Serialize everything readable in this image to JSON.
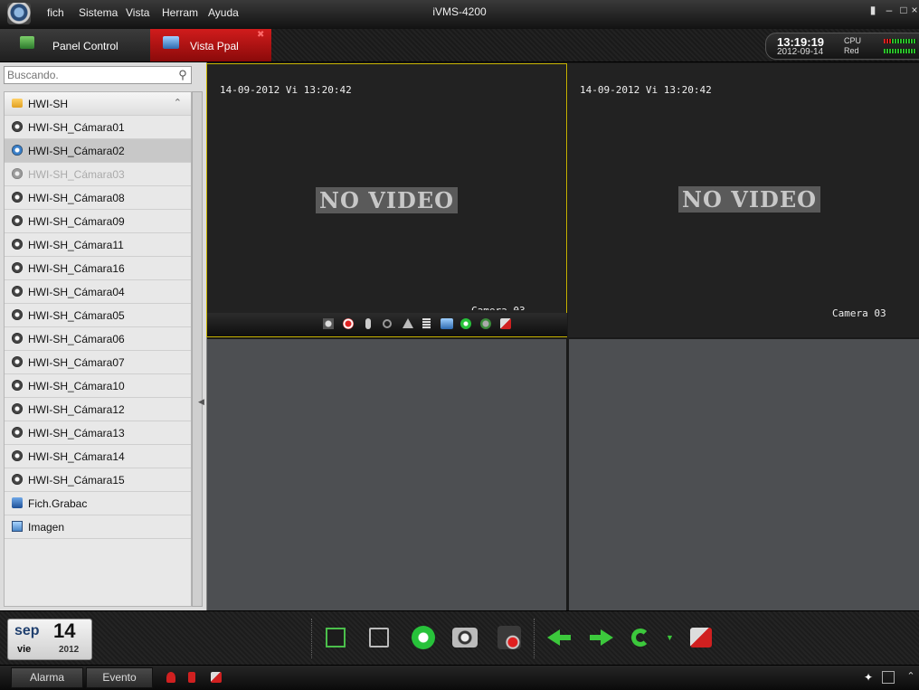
{
  "menubar": {
    "items": [
      "fich",
      "Sistema",
      "Vista",
      "Herram",
      "Ayuda"
    ],
    "title": "iVMS-4200"
  },
  "tabs": {
    "panel_control": "Panel Control",
    "vista_ppal": "Vista Ppal"
  },
  "clock": {
    "time": "13:19:19",
    "date": "2012-09-14",
    "cpu_label": "CPU",
    "net_label": "Red"
  },
  "search": {
    "placeholder": "Buscando."
  },
  "tree": {
    "group": "HWI-SH",
    "cameras": [
      {
        "label": "HWI-SH_Cámara01",
        "state": "normal"
      },
      {
        "label": "HWI-SH_Cámara02",
        "state": "selected"
      },
      {
        "label": "HWI-SH_Cámara03",
        "state": "disabled"
      },
      {
        "label": "HWI-SH_Cámara08",
        "state": "normal"
      },
      {
        "label": "HWI-SH_Cámara09",
        "state": "normal"
      },
      {
        "label": "HWI-SH_Cámara11",
        "state": "normal"
      },
      {
        "label": "HWI-SH_Cámara16",
        "state": "normal"
      },
      {
        "label": "HWI-SH_Cámara04",
        "state": "normal"
      },
      {
        "label": "HWI-SH_Cámara05",
        "state": "normal"
      },
      {
        "label": "HWI-SH_Cámara06",
        "state": "normal"
      },
      {
        "label": "HWI-SH_Cámara07",
        "state": "normal"
      },
      {
        "label": "HWI-SH_Cámara10",
        "state": "normal"
      },
      {
        "label": "HWI-SH_Cámara12",
        "state": "normal"
      },
      {
        "label": "HWI-SH_Cámara13",
        "state": "normal"
      },
      {
        "label": "HWI-SH_Cámara14",
        "state": "normal"
      },
      {
        "label": "HWI-SH_Cámara15",
        "state": "normal"
      }
    ],
    "recordings": "Fich.Grabac",
    "images": "Imagen"
  },
  "video": {
    "pane1": {
      "timestamp": "14-09-2012 Vi 13:20:42",
      "status": "NO VIDEO",
      "camera": "Camera 03"
    },
    "pane2": {
      "timestamp": "14-09-2012 Vi 13:20:42",
      "status": "NO VIDEO",
      "camera": "Camera 03"
    }
  },
  "datebox": {
    "month": "sep",
    "day": "14",
    "weekday": "vie",
    "year": "2012"
  },
  "statusbar": {
    "alarm_tab": "Alarma",
    "event_tab": "Evento"
  },
  "colors": {
    "accent_red": "#c0141b",
    "selected_border": "#c8b400",
    "stop_green": "#27c23a",
    "arrow_green": "#3cc83c"
  }
}
